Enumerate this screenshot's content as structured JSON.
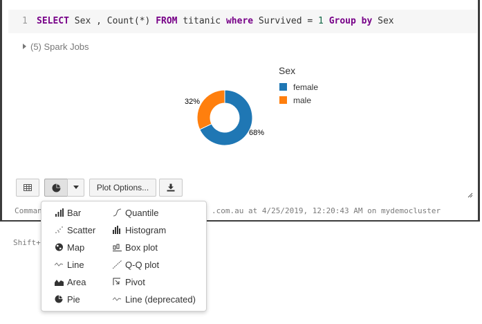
{
  "code": {
    "line_number": "1",
    "tokens": [
      {
        "text": "SELECT",
        "kind": "kw"
      },
      {
        "text": " Sex , Count(*) ",
        "kind": "plain"
      },
      {
        "text": "FROM",
        "kind": "kw"
      },
      {
        "text": " titanic ",
        "kind": "plain"
      },
      {
        "text": "where",
        "kind": "kw"
      },
      {
        "text": " Survived = ",
        "kind": "plain"
      },
      {
        "text": "1",
        "kind": "num"
      },
      {
        "text": " ",
        "kind": "plain"
      },
      {
        "text": "Group",
        "kind": "kw"
      },
      {
        "text": " ",
        "kind": "plain"
      },
      {
        "text": "by",
        "kind": "kw"
      },
      {
        "text": " Sex",
        "kind": "plain"
      }
    ]
  },
  "spark_jobs": "(5) Spark Jobs",
  "chart_data": {
    "type": "pie",
    "categories": [
      "female",
      "male"
    ],
    "values": [
      68,
      32
    ],
    "value_labels": [
      "68%",
      "32%"
    ],
    "legend_title": "Sex",
    "legend_placement": "right",
    "colors": [
      "#1f77b4",
      "#ff7f0e"
    ],
    "donut": true
  },
  "toolbar": {
    "plot_options_label": "Plot Options..."
  },
  "status": {
    "left": "Comman",
    "right": ".com.au at 4/25/2019, 12:20:43 AM on mydemocluster"
  },
  "shift_hint": "Shift+",
  "plot_menu": {
    "left": [
      {
        "label": "Bar",
        "icon": "bar-chart-icon"
      },
      {
        "label": "Scatter",
        "icon": "scatter-icon"
      },
      {
        "label": "Map",
        "icon": "globe-icon"
      },
      {
        "label": "Line",
        "icon": "line-chart-icon"
      },
      {
        "label": "Area",
        "icon": "area-chart-icon"
      },
      {
        "label": "Pie",
        "icon": "pie-chart-icon"
      }
    ],
    "right": [
      {
        "label": "Quantile",
        "icon": "quantile-icon"
      },
      {
        "label": "Histogram",
        "icon": "histogram-icon"
      },
      {
        "label": "Box plot",
        "icon": "box-plot-icon"
      },
      {
        "label": "Q-Q plot",
        "icon": "qq-plot-icon"
      },
      {
        "label": "Pivot",
        "icon": "pivot-icon"
      },
      {
        "label": "Line (deprecated)",
        "icon": "line-chart-icon"
      }
    ]
  }
}
